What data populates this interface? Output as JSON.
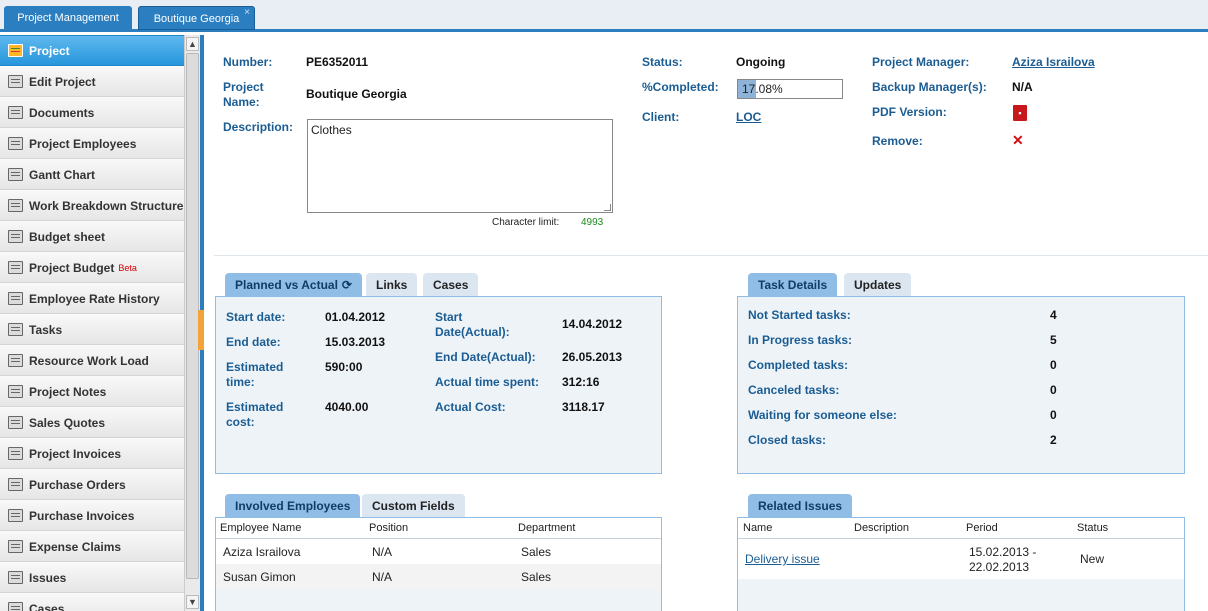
{
  "tabs": [
    "Project Management",
    "Boutique Georgia"
  ],
  "tab_close_glyph": "×",
  "sidebar": {
    "items": [
      {
        "label": "Project",
        "icon": "project-icon"
      },
      {
        "label": "Edit Project",
        "icon": "edit-icon"
      },
      {
        "label": "Documents",
        "icon": "documents-icon"
      },
      {
        "label": "Project Employees",
        "icon": "employees-icon"
      },
      {
        "label": "Gantt Chart",
        "icon": "gantt-icon"
      },
      {
        "label": "Work Breakdown Structure",
        "icon": "wbs-icon"
      },
      {
        "label": "Budget sheet",
        "icon": "budget-sheet-icon"
      },
      {
        "label": "Project Budget",
        "icon": "project-budget-icon",
        "badge": "Beta"
      },
      {
        "label": "Employee Rate History",
        "icon": "rate-history-icon"
      },
      {
        "label": "Tasks",
        "icon": "tasks-icon"
      },
      {
        "label": "Resource Work Load",
        "icon": "workload-icon"
      },
      {
        "label": "Project Notes",
        "icon": "notes-icon"
      },
      {
        "label": "Sales Quotes",
        "icon": "sales-quotes-icon"
      },
      {
        "label": "Project Invoices",
        "icon": "invoices-icon"
      },
      {
        "label": "Purchase Orders",
        "icon": "purchase-orders-icon"
      },
      {
        "label": "Purchase Invoices",
        "icon": "purchase-invoices-icon"
      },
      {
        "label": "Expense Claims",
        "icon": "expense-icon"
      },
      {
        "label": "Issues",
        "icon": "issues-icon"
      },
      {
        "label": "Cases",
        "icon": "cases-icon"
      }
    ]
  },
  "details": {
    "number_label": "Number:",
    "number": "PE6352011",
    "name_label_1": "Project",
    "name_label_2": "Name:",
    "name": "Boutique Georgia",
    "description_label": "Description:",
    "description": "Clothes",
    "char_limit_label": "Character limit:",
    "char_limit": "4993",
    "status_label": "Status:",
    "status": "Ongoing",
    "completed_label": "%Completed:",
    "completed": "17.08%",
    "completed_fraction": 0.1708,
    "client_label": "Client:",
    "client": "LOC",
    "manager_label": "Project Manager:",
    "manager": "Aziza Israilova",
    "backup_label": "Backup Manager(s):",
    "backup": "N/A",
    "pdf_label": "PDF Version:",
    "remove_label": "Remove:"
  },
  "planned": {
    "tabs": [
      "Planned vs Actual",
      "Links",
      "Cases"
    ],
    "start_label": "Start date:",
    "start": "01.04.2012",
    "end_label": "End date:",
    "end": "15.03.2013",
    "est_time_label_1": "Estimated",
    "est_time_label_2": "time:",
    "est_time": "590:00",
    "est_cost_label_1": "Estimated",
    "est_cost_label_2": "cost:",
    "est_cost": "4040.00",
    "start_actual_label_1": "Start",
    "start_actual_label_2": "Date(Actual):",
    "start_actual": "14.04.2012",
    "end_actual_label": "End Date(Actual):",
    "end_actual": "26.05.2013",
    "time_spent_label": "Actual time spent:",
    "time_spent": "312:16",
    "actual_cost_label": "Actual Cost:",
    "actual_cost": "3118.17"
  },
  "task_details": {
    "tabs": [
      "Task Details",
      "Updates"
    ],
    "rows": [
      {
        "label": "Not Started tasks:",
        "value": "4"
      },
      {
        "label": "In Progress tasks:",
        "value": "5"
      },
      {
        "label": "Completed tasks:",
        "value": "0"
      },
      {
        "label": "Canceled tasks:",
        "value": "0"
      },
      {
        "label": "Waiting for someone else:",
        "value": "0"
      },
      {
        "label": "Closed tasks:",
        "value": "2"
      }
    ]
  },
  "employees": {
    "tabs": [
      "Involved Employees",
      "Custom Fields"
    ],
    "columns": [
      "Employee Name",
      "Position",
      "Department"
    ],
    "rows": [
      [
        "Aziza Israilova",
        "N/A",
        "Sales"
      ],
      [
        "Susan Gimon",
        "N/A",
        "Sales"
      ]
    ]
  },
  "issues": {
    "tabs": [
      "Related Issues"
    ],
    "columns": [
      "Name",
      "Description",
      "Period",
      "Status"
    ],
    "rows": [
      {
        "name": "Delivery issue",
        "description": "",
        "period_1": "15.02.2013 -",
        "period_2": "22.02.2013",
        "status": "New"
      }
    ]
  },
  "colors": {
    "accent": "#2b7fc1",
    "active_menu": "#2696dc",
    "label_blue": "#1b5d93",
    "panel_border": "#8fbde6"
  }
}
